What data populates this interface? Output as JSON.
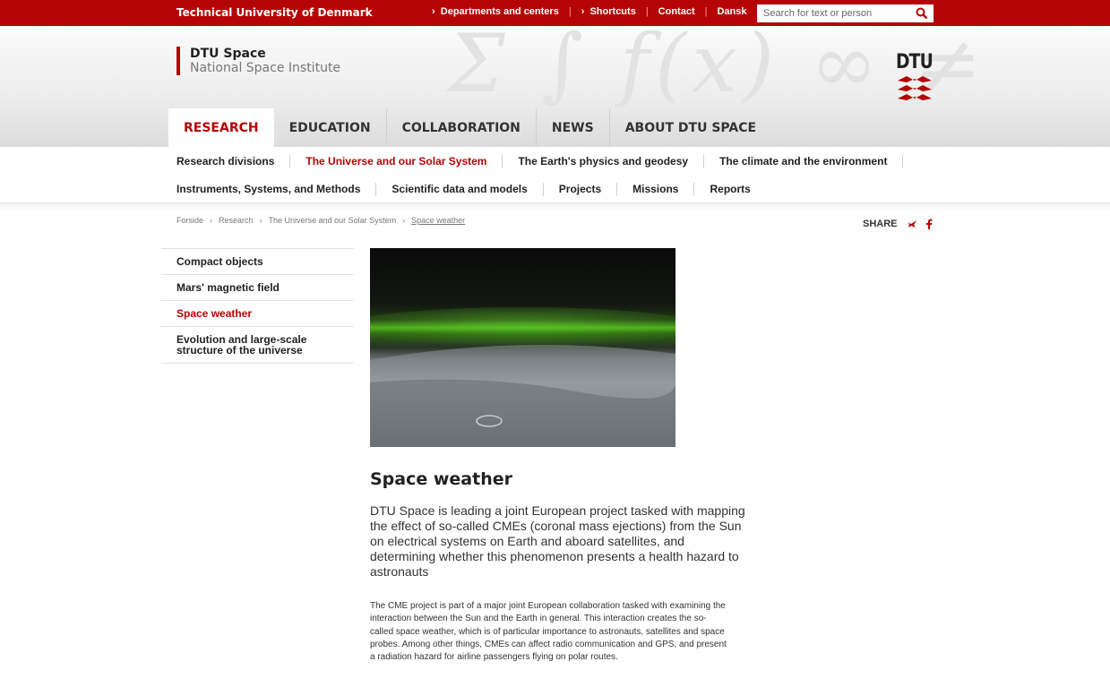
{
  "topbar": {
    "university": "Technical University of Denmark",
    "links": [
      "Departments and centers",
      "Shortcuts",
      "Contact",
      "Dansk"
    ],
    "search_placeholder": "Search for text or person",
    "accent": "#b50404"
  },
  "brand": {
    "title": "DTU Space",
    "subtitle": "National Space Institute",
    "logo_text": "DTU"
  },
  "main_nav": [
    "RESEARCH",
    "EDUCATION",
    "COLLABORATION",
    "NEWS",
    "ABOUT DTU SPACE"
  ],
  "sub_nav": {
    "row1": [
      "Research divisions",
      "The Universe and our Solar System",
      "The Earth's physics and geodesy",
      "The climate and the environment"
    ],
    "row2": [
      "Instruments, Systems, and Methods",
      "Scientific data and models",
      "Projects",
      "Missions",
      "Reports"
    ]
  },
  "breadcrumb": [
    "Forside",
    "Research",
    "The Universe and our Solar System",
    "Space weather"
  ],
  "share_label": "SHARE",
  "side_menu": [
    "Compact objects",
    "Mars' magnetic field",
    "Space weather",
    "Evolution and large-scale structure of the universe"
  ],
  "article": {
    "title": "Space weather",
    "lead": "DTU Space is leading a joint European project tasked with mapping the effect of so-called CMEs (coronal mass ejections) from the Sun on electrical systems on Earth and aboard satellites, and determining whether this phenomenon presents a health hazard to astronauts",
    "body": "The CME project is part of a major joint European collaboration tasked with examining the interaction between the Sun and the Earth in general. This interaction creates the so-called space weather, which is of particular importance to astronauts, satellites and space probes. Among other things, CMEs can affect radio communication and GPS, and present a radiation hazard for airline passengers flying on polar routes."
  }
}
